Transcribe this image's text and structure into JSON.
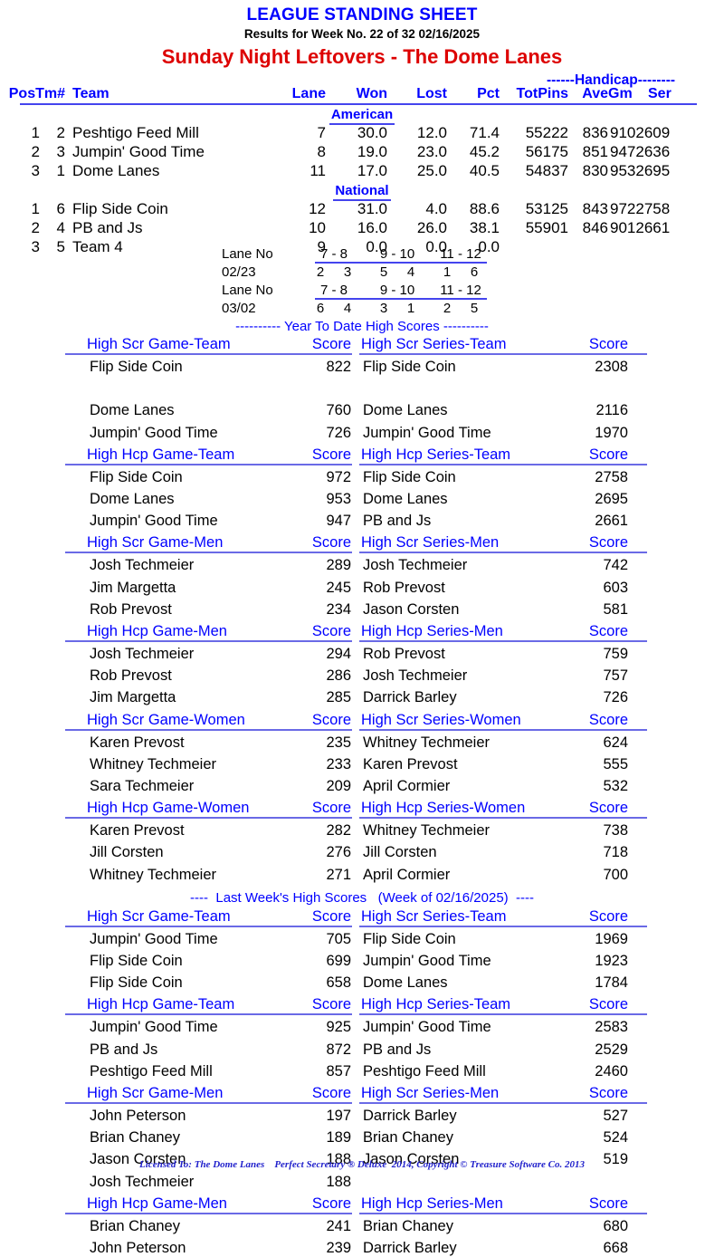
{
  "header": {
    "title": "LEAGUE STANDING SHEET",
    "subtitle": "Results for Week No. 22 of 32    02/16/2025",
    "league": "Sunday Night Leftovers - The Dome Lanes"
  },
  "standings": {
    "handicap_label": "------Handicap--------",
    "columns": {
      "pos_tm": "PosTm#",
      "team": "Team",
      "lane": "Lane",
      "won": "Won",
      "lost": "Lost",
      "pct": "Pct",
      "totpins": "TotPins",
      "ave": "Ave",
      "gm": "Gm",
      "ser": "Ser"
    },
    "divisions": [
      {
        "name": "American",
        "rows": [
          {
            "pos": "1",
            "tm": "2",
            "team": "Peshtigo Feed Mill",
            "lane": "7",
            "won": "30.0",
            "lost": "12.0",
            "pct": "71.4",
            "totpins": "55222",
            "ave": "836",
            "gmser": "9102609"
          },
          {
            "pos": "2",
            "tm": "3",
            "team": "Jumpin' Good Time",
            "lane": "8",
            "won": "19.0",
            "lost": "23.0",
            "pct": "45.2",
            "totpins": "56175",
            "ave": "851",
            "gmser": "9472636"
          },
          {
            "pos": "3",
            "tm": "1",
            "team": "Dome Lanes",
            "lane": "11",
            "won": "17.0",
            "lost": "25.0",
            "pct": "40.5",
            "totpins": "54837",
            "ave": "830",
            "gmser": "9532695"
          }
        ]
      },
      {
        "name": "National",
        "rows": [
          {
            "pos": "1",
            "tm": "6",
            "team": "Flip Side Coin",
            "lane": "12",
            "won": "31.0",
            "lost": "4.0",
            "pct": "88.6",
            "totpins": "53125",
            "ave": "843",
            "gmser": "9722758"
          },
          {
            "pos": "2",
            "tm": "4",
            "team": "PB and Js",
            "lane": "10",
            "won": "16.0",
            "lost": "26.0",
            "pct": "38.1",
            "totpins": "55901",
            "ave": "846",
            "gmser": "9012661"
          },
          {
            "pos": "3",
            "tm": "5",
            "team": "Team 4",
            "lane": "9",
            "won": "0.0",
            "lost": "0.0",
            "pct": "0.0",
            "totpins": "",
            "ave": "",
            "gmser": ""
          }
        ]
      }
    ]
  },
  "lane_schedule": {
    "label": "Lane No",
    "pairs": [
      "7 - 8",
      "9 - 10",
      "11 - 12"
    ],
    "weeks": [
      {
        "date": "02/23",
        "teams": [
          "2",
          "3",
          "5",
          "4",
          "1",
          "6"
        ]
      },
      {
        "date": "03/02",
        "teams": [
          "6",
          "4",
          "3",
          "1",
          "2",
          "5"
        ]
      }
    ]
  },
  "ytd": {
    "banner": "---------- Year To Date High Scores ----------",
    "blocks": [
      {
        "left_header": "High Scr Game-Team",
        "left_score_header": "Score",
        "right_header": "High Scr Series-Team",
        "right_score_header": "Score",
        "rows": [
          {
            "ln": "Flip Side Coin",
            "ls": "822",
            "rn": "Flip Side Coin",
            "rs": "2308"
          },
          {
            "ln": "",
            "ls": "",
            "rn": "",
            "rs": ""
          },
          {
            "ln": "Dome Lanes",
            "ls": "760",
            "rn": "Dome Lanes",
            "rs": "2116"
          },
          {
            "ln": "Jumpin' Good Time",
            "ls": "726",
            "rn": "Jumpin' Good Time",
            "rs": "1970"
          }
        ]
      },
      {
        "left_header": "High Hcp Game-Team",
        "left_score_header": "Score",
        "right_header": "High Hcp Series-Team",
        "right_score_header": "Score",
        "rows": [
          {
            "ln": "Flip Side Coin",
            "ls": "972",
            "rn": "Flip Side Coin",
            "rs": "2758"
          },
          {
            "ln": "Dome Lanes",
            "ls": "953",
            "rn": "Dome Lanes",
            "rs": "2695"
          },
          {
            "ln": "Jumpin' Good Time",
            "ls": "947",
            "rn": "PB and Js",
            "rs": "2661"
          }
        ]
      },
      {
        "left_header": "High Scr Game-Men",
        "left_score_header": "Score",
        "right_header": "High Scr Series-Men",
        "right_score_header": "Score",
        "rows": [
          {
            "ln": "Josh Techmeier",
            "ls": "289",
            "rn": "Josh Techmeier",
            "rs": "742"
          },
          {
            "ln": "Jim Margetta",
            "ls": "245",
            "rn": "Rob Prevost",
            "rs": "603"
          },
          {
            "ln": "Rob Prevost",
            "ls": "234",
            "rn": "Jason Corsten",
            "rs": "581"
          }
        ]
      },
      {
        "left_header": "High Hcp Game-Men",
        "left_score_header": "Score",
        "right_header": "High Hcp Series-Men",
        "right_score_header": "Score",
        "rows": [
          {
            "ln": "Josh Techmeier",
            "ls": "294",
            "rn": "Rob Prevost",
            "rs": "759"
          },
          {
            "ln": "Rob Prevost",
            "ls": "286",
            "rn": "Josh Techmeier",
            "rs": "757"
          },
          {
            "ln": "Jim Margetta",
            "ls": "285",
            "rn": "Darrick Barley",
            "rs": "726"
          }
        ]
      },
      {
        "left_header": "High Scr Game-Women",
        "left_score_header": "Score",
        "right_header": "High Scr Series-Women",
        "right_score_header": "Score",
        "rows": [
          {
            "ln": "Karen Prevost",
            "ls": "235",
            "rn": "Whitney Techmeier",
            "rs": "624"
          },
          {
            "ln": "Whitney Techmeier",
            "ls": "233",
            "rn": "Karen Prevost",
            "rs": "555"
          },
          {
            "ln": "Sara Techmeier",
            "ls": "209",
            "rn": "April Cormier",
            "rs": "532"
          }
        ]
      },
      {
        "left_header": "High Hcp Game-Women",
        "left_score_header": "Score",
        "right_header": "High Hcp Series-Women",
        "right_score_header": "Score",
        "rows": [
          {
            "ln": "Karen Prevost",
            "ls": "282",
            "rn": "Whitney Techmeier",
            "rs": "738"
          },
          {
            "ln": "Jill Corsten",
            "ls": "276",
            "rn": "Jill Corsten",
            "rs": "718"
          },
          {
            "ln": "Whitney Techmeier",
            "ls": "271",
            "rn": "April Cormier",
            "rs": "700"
          }
        ]
      }
    ]
  },
  "last_week": {
    "banner": "----  Last Week's High Scores   (Week of 02/16/2025)  ----",
    "blocks": [
      {
        "left_header": "High Scr Game-Team",
        "left_score_header": "Score",
        "right_header": "High Scr Series-Team",
        "right_score_header": "Score",
        "rows": [
          {
            "ln": "Jumpin' Good Time",
            "ls": "705",
            "rn": "Flip Side Coin",
            "rs": "1969"
          },
          {
            "ln": "Flip Side Coin",
            "ls": "699",
            "rn": "Jumpin' Good Time",
            "rs": "1923"
          },
          {
            "ln": "Flip Side Coin",
            "ls": "658",
            "rn": "Dome Lanes",
            "rs": "1784"
          }
        ]
      },
      {
        "left_header": "High Hcp Game-Team",
        "left_score_header": "Score",
        "right_header": "High Hcp Series-Team",
        "right_score_header": "Score",
        "rows": [
          {
            "ln": "Jumpin' Good Time",
            "ls": "925",
            "rn": "Jumpin' Good Time",
            "rs": "2583"
          },
          {
            "ln": "PB and Js",
            "ls": "872",
            "rn": "PB and Js",
            "rs": "2529"
          },
          {
            "ln": "Peshtigo Feed Mill",
            "ls": "857",
            "rn": "Peshtigo Feed Mill",
            "rs": "2460"
          }
        ]
      },
      {
        "left_header": "High Scr Game-Men",
        "left_score_header": "Score",
        "right_header": "High Scr Series-Men",
        "right_score_header": "Score",
        "rows": [
          {
            "ln": "John Peterson",
            "ls": "197",
            "rn": "Darrick Barley",
            "rs": "527"
          },
          {
            "ln": "Brian Chaney",
            "ls": "189",
            "rn": "Brian Chaney",
            "rs": "524"
          },
          {
            "ln": "Jason Corsten",
            "ls": "188",
            "rn": "Jason Corsten",
            "rs": "519"
          },
          {
            "ln": "Josh Techmeier",
            "ls": "188",
            "rn": "",
            "rs": ""
          }
        ]
      },
      {
        "left_header": "High Hcp Game-Men",
        "left_score_header": "Score",
        "right_header": "High Hcp Series-Men",
        "right_score_header": "Score",
        "rows": [
          {
            "ln": "Brian Chaney",
            "ls": "241",
            "rn": "Brian Chaney",
            "rs": "680"
          },
          {
            "ln": "John Peterson",
            "ls": "239",
            "rn": "Darrick Barley",
            "rs": "668"
          }
        ]
      }
    ]
  },
  "footer": {
    "text": "Licensed To: The Dome Lanes    Perfect Secretary ® Deluxe  2014, Copyright © Treasure Software Co. 2013"
  },
  "colors": {
    "blue": "#0000ff",
    "red": "#dd0000",
    "rule": "#4444ee"
  }
}
